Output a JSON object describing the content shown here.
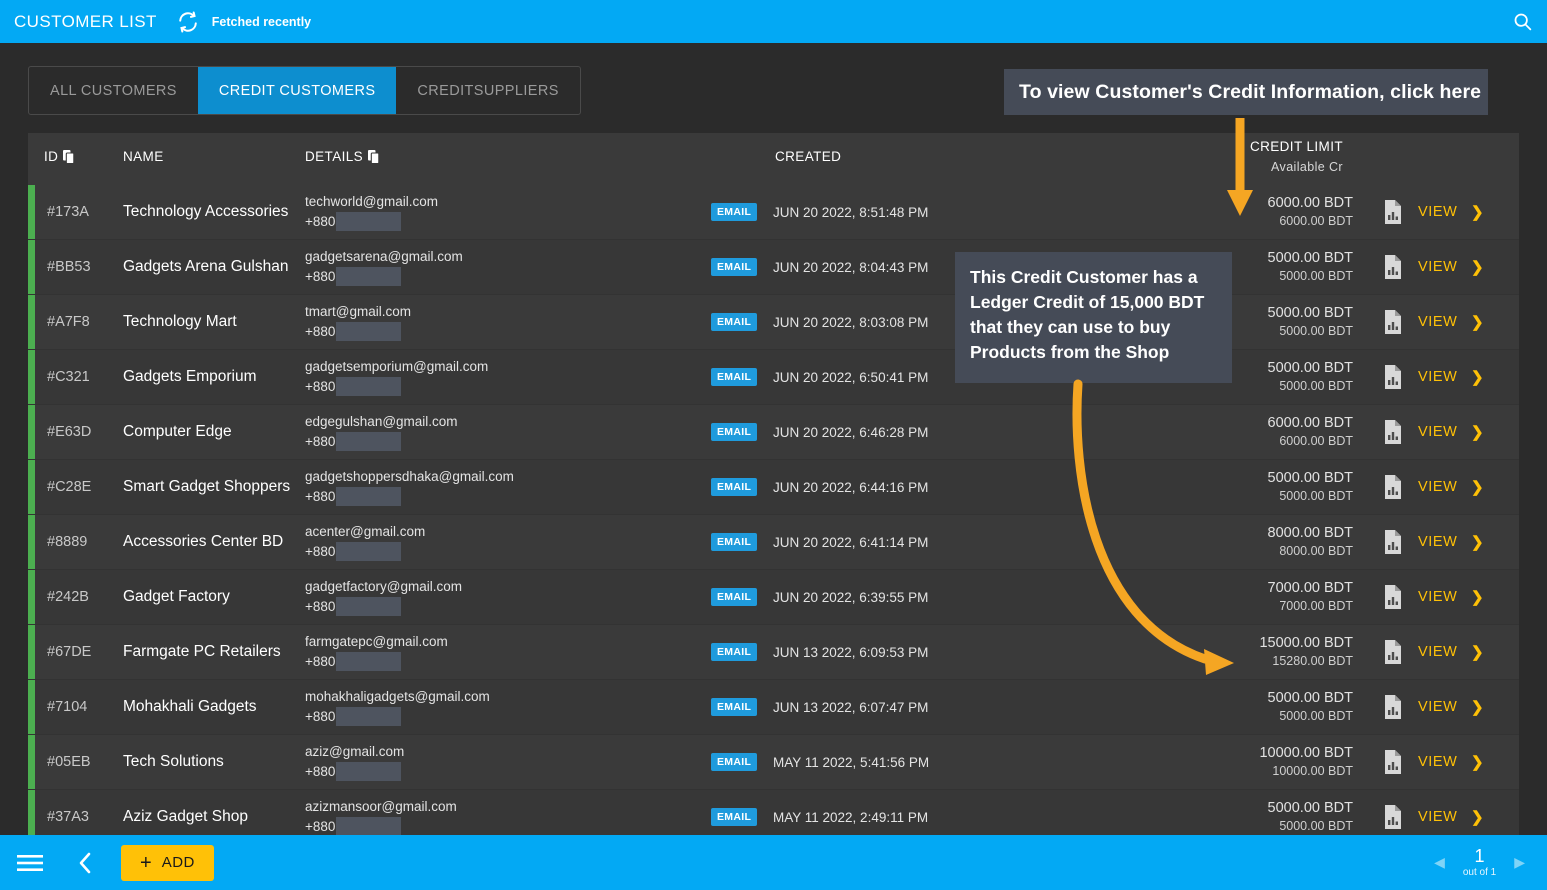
{
  "topbar": {
    "title": "CUSTOMER LIST",
    "refresh_icon": "refresh-icon",
    "fetched_status": "Fetched recently",
    "search_icon": "search-icon"
  },
  "tabs": [
    {
      "label": "ALL CUSTOMERS",
      "active": false
    },
    {
      "label": "CREDIT CUSTOMERS",
      "active": true
    },
    {
      "label": "CREDITSUPPLIERS",
      "active": false
    }
  ],
  "callouts": {
    "top": "To view Customer's Credit Information, click here",
    "middle": "This Credit Customer has a Ledger Credit of 15,000 BDT that they can use to buy Products from the Shop"
  },
  "table": {
    "headers": {
      "id": "ID",
      "name": "NAME",
      "details": "DETAILS",
      "created": "CREATED",
      "credit_limit": "CREDIT LIMIT",
      "available_cr": "Available Cr"
    },
    "header_icons": {
      "id_copy": "copy-icon",
      "details_copy": "copy-icon"
    },
    "row_action": {
      "chart_icon": "chart-report-icon",
      "view_label": "VIEW",
      "chevron_icon": "chevron-right-icon",
      "email_badge": "EMAIL",
      "phone_prefix": "+880"
    },
    "rows": [
      {
        "id": "#173A",
        "name": "Technology Accessories",
        "email": "techworld@gmail.com",
        "phone": "+880",
        "created": "JUN 20 2022, 8:51:48 PM",
        "credit_limit": "6000.00 BDT",
        "available": "6000.00 BDT"
      },
      {
        "id": "#BB53",
        "name": "Gadgets Arena Gulshan",
        "email": "gadgetsarena@gmail.com",
        "phone": "+880",
        "created": "JUN 20 2022, 8:04:43 PM",
        "credit_limit": "5000.00 BDT",
        "available": "5000.00 BDT"
      },
      {
        "id": "#A7F8",
        "name": "Technology Mart",
        "email": "tmart@gmail.com",
        "phone": "+880",
        "created": "JUN 20 2022, 8:03:08 PM",
        "credit_limit": "5000.00 BDT",
        "available": "5000.00 BDT"
      },
      {
        "id": "#C321",
        "name": "Gadgets Emporium",
        "email": "gadgetsemporium@gmail.com",
        "phone": "+880",
        "created": "JUN 20 2022, 6:50:41 PM",
        "credit_limit": "5000.00 BDT",
        "available": "5000.00 BDT"
      },
      {
        "id": "#E63D",
        "name": "Computer Edge",
        "email": "edgegulshan@gmail.com",
        "phone": "+880",
        "created": "JUN 20 2022, 6:46:28 PM",
        "credit_limit": "6000.00 BDT",
        "available": "6000.00 BDT"
      },
      {
        "id": "#C28E",
        "name": "Smart Gadget Shoppers",
        "email": "gadgetshoppersdhaka@gmail.com",
        "phone": "+880",
        "created": "JUN 20 2022, 6:44:16 PM",
        "credit_limit": "5000.00 BDT",
        "available": "5000.00 BDT"
      },
      {
        "id": "#8889",
        "name": "Accessories Center BD",
        "email": "acenter@gmail.com",
        "phone": "+880",
        "created": "JUN 20 2022, 6:41:14 PM",
        "credit_limit": "8000.00 BDT",
        "available": "8000.00 BDT"
      },
      {
        "id": "#242B",
        "name": "Gadget Factory",
        "email": "gadgetfactory@gmail.com",
        "phone": "+880",
        "created": "JUN 20 2022, 6:39:55 PM",
        "credit_limit": "7000.00 BDT",
        "available": "7000.00 BDT"
      },
      {
        "id": "#67DE",
        "name": "Farmgate PC Retailers",
        "email": "farmgatepc@gmail.com",
        "phone": "+880",
        "created": "JUN 13 2022, 6:09:53 PM",
        "credit_limit": "15000.00 BDT",
        "available": "15280.00 BDT"
      },
      {
        "id": "#7104",
        "name": "Mohakhali Gadgets",
        "email": "mohakhaligadgets@gmail.com",
        "phone": "+880",
        "created": "JUN 13 2022, 6:07:47 PM",
        "credit_limit": "5000.00 BDT",
        "available": "5000.00 BDT"
      },
      {
        "id": "#05EB",
        "name": "Tech Solutions",
        "email": "aziz@gmail.com",
        "phone": "+880",
        "created": "MAY 11 2022, 5:41:56 PM",
        "credit_limit": "10000.00 BDT",
        "available": "10000.00 BDT"
      },
      {
        "id": "#37A3",
        "name": "Aziz Gadget Shop",
        "email": "azizmansoor@gmail.com",
        "phone": "+880",
        "created": "MAY 11 2022, 2:49:11 PM",
        "credit_limit": "5000.00 BDT",
        "available": "5000.00 BDT"
      }
    ]
  },
  "bottombar": {
    "menu_icon": "hamburger-menu-icon",
    "back_icon": "chevron-left-icon",
    "add_plus": "+",
    "add_label": "ADD",
    "prev_icon": "triangle-left-icon",
    "next_icon": "triangle-right-icon",
    "page_number": "1",
    "page_total": "out of 1"
  },
  "colors": {
    "accent_blue": "#03a9f4",
    "tab_active": "#0d8ecf",
    "amber": "#ffc107",
    "row_accent_green": "#4caf50",
    "callout_bg": "#454b57",
    "badge_blue": "#1f9bdd"
  }
}
